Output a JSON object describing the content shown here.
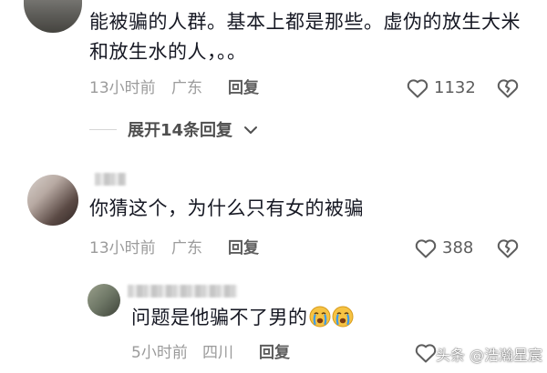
{
  "comments": [
    {
      "text": "能被骗的人群。基本上都是那些。虚伪的放生大米和放生水的人，。。",
      "time": "13小时前",
      "location": "广东",
      "reply_label": "回复",
      "likes": "1132"
    },
    {
      "text": "你猜这个，为什么只有女的被骗",
      "time": "13小时前",
      "location": "广东",
      "reply_label": "回复",
      "likes": "388"
    }
  ],
  "expand_replies_label": "展开14条回复",
  "sub_reply": {
    "text": "问题是他骗不了男的",
    "emojis": [
      "crying-emoji",
      "crying-emoji"
    ],
    "time": "5小时前",
    "location": "四川",
    "reply_label": "回复"
  },
  "watermark": "头条 @浩瀚星宸",
  "icons": {
    "like": "heart-outline-icon",
    "dislike": "broken-heart-outline-icon",
    "expand": "chevron-down-icon"
  },
  "colors": {
    "text": "#161823",
    "meta": "#9b9b9b",
    "reply": "#5d5d5d"
  }
}
